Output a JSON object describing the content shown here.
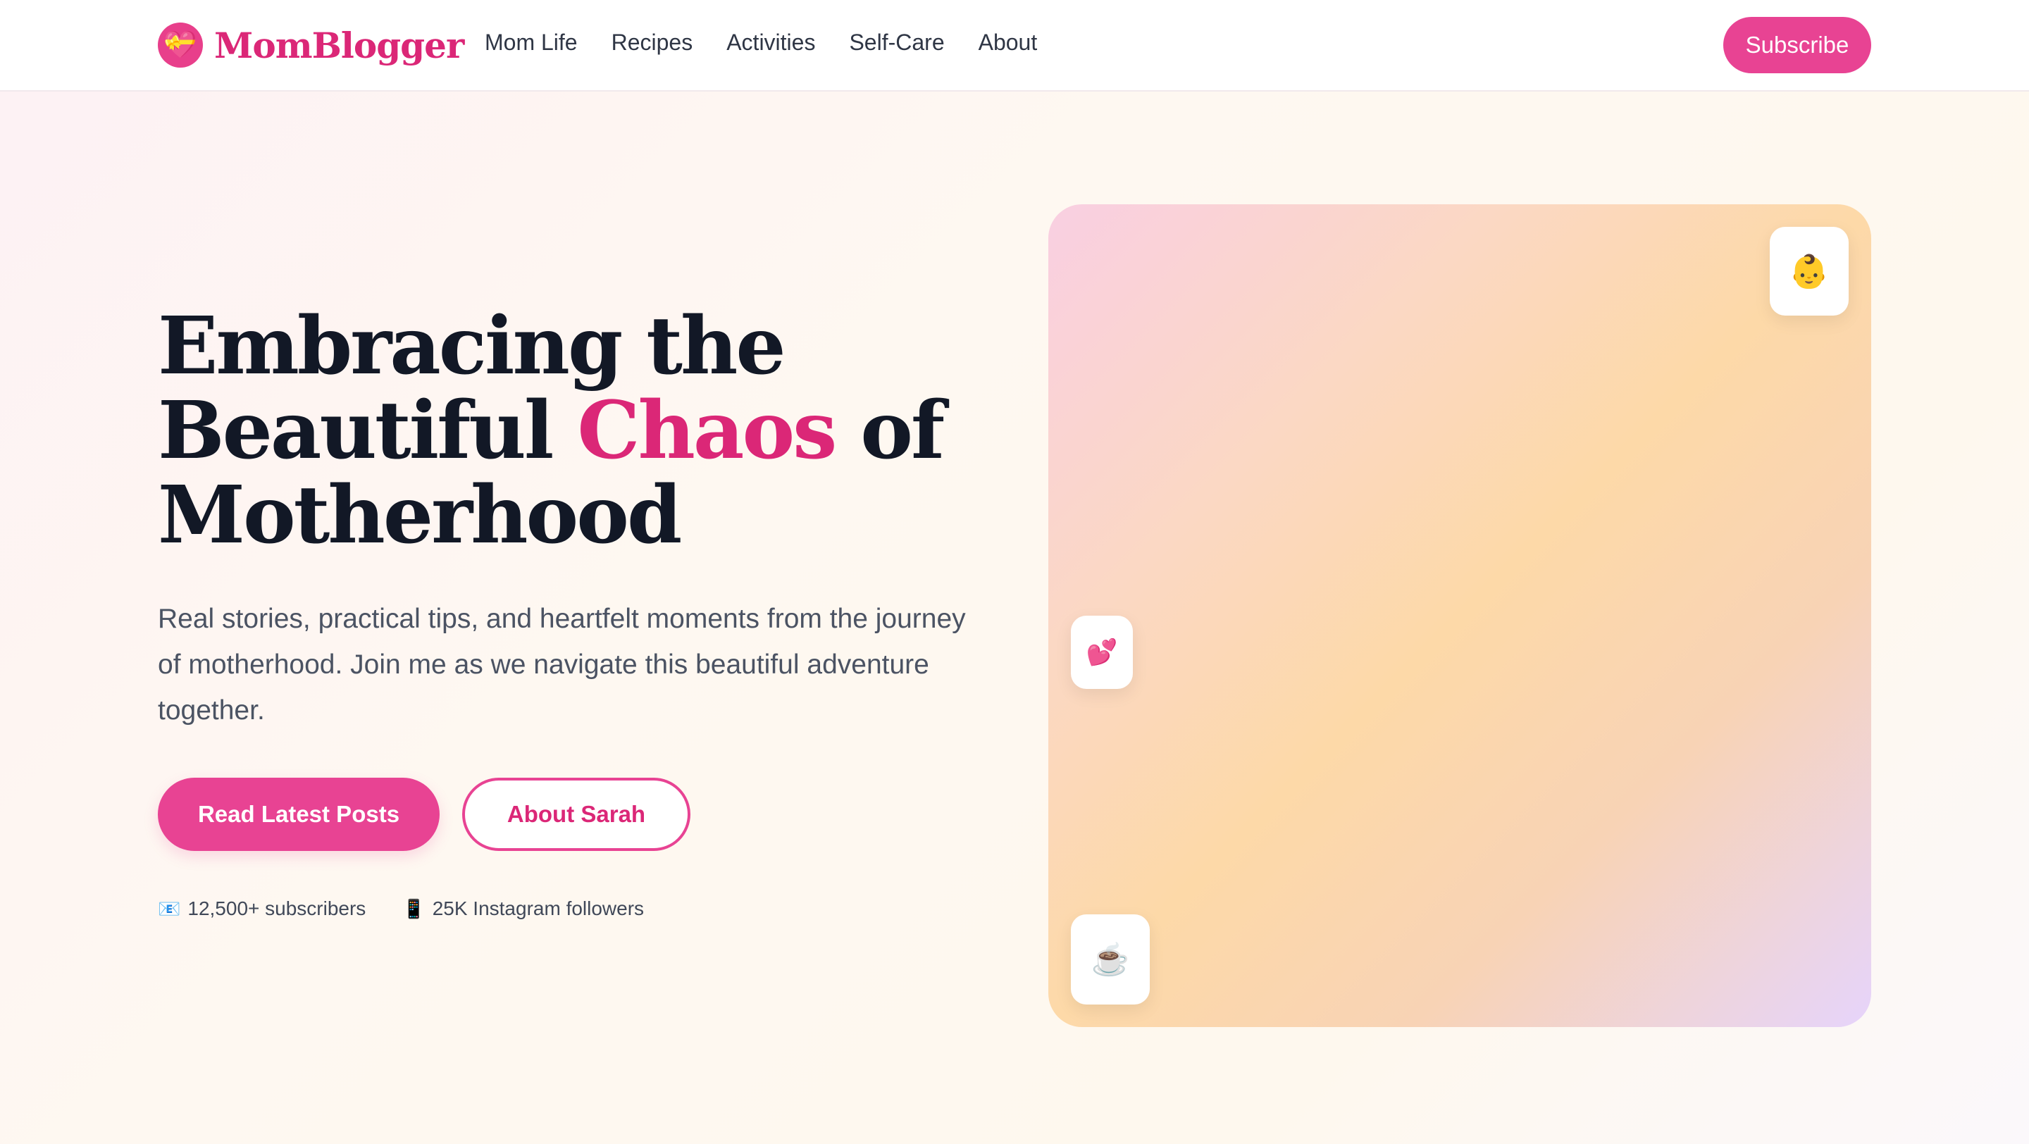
{
  "header": {
    "logo_icon": "💝",
    "logo_text": "MomBlogger",
    "nav": [
      "Mom Life",
      "Recipes",
      "Activities",
      "Self-Care",
      "About"
    ],
    "subscribe_label": "Subscribe"
  },
  "hero": {
    "title_line1": "Embracing the",
    "title_line2_start": "Beautiful ",
    "title_accent": "Chaos",
    "title_line2_end": " of",
    "title_line3": "Motherhood",
    "description": "Real stories, practical tips, and heartfelt moments from the journey of motherhood. Join me as we navigate this beautiful adventure together.",
    "primary_button": "Read Latest Posts",
    "secondary_button": "About Sarah",
    "stats": [
      {
        "icon": "📧",
        "text": "12,500+ subscribers"
      },
      {
        "icon": "📱",
        "text": "25K Instagram followers"
      }
    ]
  },
  "image_panel": {
    "badges": [
      "👶",
      "💕",
      "☕"
    ]
  },
  "colors": {
    "accent": "#e84393",
    "accent_text": "#db2777",
    "heading": "#121826"
  }
}
